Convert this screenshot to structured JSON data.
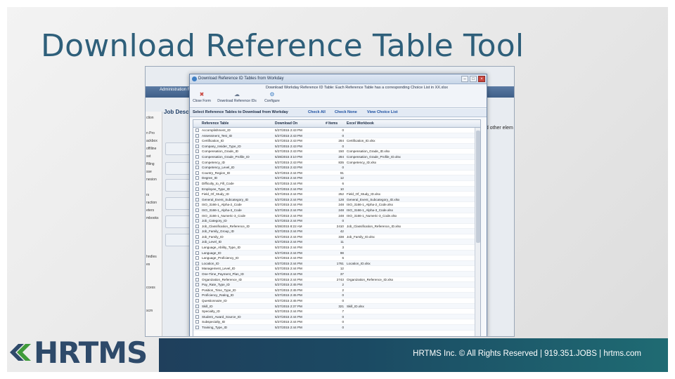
{
  "slide": {
    "title": "Download Reference Table Tool",
    "footer": "HRTMS Inc. © All Rights Reserved | 919.351.JOBS | hrtms.com",
    "logo_text": "HRTMS"
  },
  "background_app": {
    "topbar_label": "Administration Ref",
    "page_header": "Job Descr",
    "right_text": "nd other elem",
    "left_items": [
      "ction",
      "",
      "n Pro",
      "ackbox",
      "offiline",
      "sst",
      "ffiling",
      "sse",
      "nesion",
      "",
      "rs",
      "raction",
      "eters",
      "mbooks",
      "",
      "",
      "",
      "",
      "hndles",
      "es",
      "",
      "",
      "ccess",
      "",
      "",
      "scm"
    ]
  },
  "dialog": {
    "title": "Download Reference ID Tables from Workday",
    "status": "Download Workday Reference ID Table: Each Reference Table has a corresponding Choice List in XX.xlsx",
    "ribbon": [
      {
        "label": "Close Form",
        "icon": "close-form-icon"
      },
      {
        "label": "Download Reference IDs",
        "icon": "download-icon"
      },
      {
        "label": "Configure",
        "icon": "gear-icon"
      }
    ],
    "select_label": "Select Reference Tables to Download from Workday",
    "links": [
      "Check All",
      "Check None",
      "View Choice List"
    ],
    "columns": [
      "Reference Table",
      "Download On",
      "# Items",
      "Excel Workbook"
    ]
  },
  "rows": [
    {
      "name": "Accomplishment_ID",
      "date": "5/27/2015 2:43 PM",
      "items": "0",
      "wb": ""
    },
    {
      "name": "Assessment_Test_ID",
      "date": "5/27/2015 2:43 PM",
      "items": "0",
      "wb": ""
    },
    {
      "name": "Certification_ID",
      "date": "5/27/2015 2:43 PM",
      "items": "284",
      "wb": "Certification_ID.xlsx"
    },
    {
      "name": "Company_Insider_Type_ID",
      "date": "5/27/2015 2:43 PM",
      "items": "0",
      "wb": ""
    },
    {
      "name": "Compensation_Grade_ID",
      "date": "5/27/2015 2:43 PM",
      "items": "150",
      "wb": "Compensation_Grade_ID.xlsx"
    },
    {
      "name": "Compensation_Grade_Profile_ID",
      "date": "5/28/2015 3:10 PM",
      "items": "284",
      "wb": "Compensation_Grade_Profile_ID.xlsx"
    },
    {
      "name": "Competency_ID",
      "date": "5/27/2015 2:43 PM",
      "items": "835",
      "wb": "Competency_ID.xlsx"
    },
    {
      "name": "Competency_Level_ID",
      "date": "5/27/2015 2:43 PM",
      "items": "0",
      "wb": ""
    },
    {
      "name": "Country_Region_ID",
      "date": "5/27/2015 2:44 PM",
      "items": "91",
      "wb": ""
    },
    {
      "name": "Degree_ID",
      "date": "5/27/2015 2:44 PM",
      "items": "12",
      "wb": ""
    },
    {
      "name": "Difficulty_to_Fill_Code",
      "date": "5/27/2015 2:44 PM",
      "items": "6",
      "wb": ""
    },
    {
      "name": "Employee_Type_ID",
      "date": "5/27/2015 2:44 PM",
      "items": "10",
      "wb": ""
    },
    {
      "name": "Field_Of_Study_ID",
      "date": "5/27/2015 2:44 PM",
      "items": "252",
      "wb": "Field_Of_Study_ID.xlsx"
    },
    {
      "name": "General_Event_Subcategory_ID",
      "date": "5/27/2015 2:44 PM",
      "items": "128",
      "wb": "General_Event_Subcategory_ID.xlsx"
    },
    {
      "name": "ISO_3166-1_Alpha-2_Code",
      "date": "5/27/2015 2:44 PM",
      "items": "248",
      "wb": "ISO_3166-1_Alpha-2_Code.xlsx"
    },
    {
      "name": "ISO_3166-1_Alpha-3_Code",
      "date": "5/27/2015 2:44 PM",
      "items": "248",
      "wb": "ISO_3166-1_Alpha-3_Code.xlsx"
    },
    {
      "name": "ISO_3166-1_Numeric-3_Code",
      "date": "5/27/2015 2:44 PM",
      "items": "248",
      "wb": "ISO_3166-1_Numeric-3_Code.xlsx"
    },
    {
      "name": "Job_Category_ID",
      "date": "5/27/2015 2:44 PM",
      "items": "0",
      "wb": ""
    },
    {
      "name": "Job_Classification_Reference_ID",
      "date": "5/28/2015 8:22 AM",
      "items": "2410",
      "wb": "Job_Classification_Reference_ID.xlsx"
    },
    {
      "name": "Job_Family_Group_ID",
      "date": "5/27/2015 2:44 PM",
      "items": "42",
      "wb": ""
    },
    {
      "name": "Job_Family_ID",
      "date": "5/27/2015 2:44 PM",
      "items": "338",
      "wb": "Job_Family_ID.xlsx"
    },
    {
      "name": "Job_Level_ID",
      "date": "5/27/2015 2:44 PM",
      "items": "11",
      "wb": ""
    },
    {
      "name": "Language_Ability_Type_ID",
      "date": "5/27/2015 2:44 PM",
      "items": "3",
      "wb": ""
    },
    {
      "name": "Language_ID",
      "date": "5/27/2015 2:44 PM",
      "items": "98",
      "wb": ""
    },
    {
      "name": "Language_Proficiency_ID",
      "date": "5/27/2015 2:44 PM",
      "items": "6",
      "wb": ""
    },
    {
      "name": "Location_ID",
      "date": "5/27/2015 2:44 PM",
      "items": "1761",
      "wb": "Location_ID.xlsx"
    },
    {
      "name": "Management_Level_ID",
      "date": "5/27/2015 2:44 PM",
      "items": "12",
      "wb": ""
    },
    {
      "name": "One-Time_Payment_Plan_ID",
      "date": "5/27/2015 2:44 PM",
      "items": "37",
      "wb": ""
    },
    {
      "name": "Organization_Reference_ID",
      "date": "5/27/2015 2:44 PM",
      "items": "2743",
      "wb": "Organization_Reference_ID.xlsx"
    },
    {
      "name": "Pay_Rate_Type_ID",
      "date": "5/27/2015 2:45 PM",
      "items": "2",
      "wb": ""
    },
    {
      "name": "Position_Time_Type_ID",
      "date": "5/27/2015 2:45 PM",
      "items": "2",
      "wb": ""
    },
    {
      "name": "Proficiency_Rating_ID",
      "date": "5/27/2015 2:45 PM",
      "items": "0",
      "wb": ""
    },
    {
      "name": "Questionnaire_ID",
      "date": "5/27/2015 2:45 PM",
      "items": "0",
      "wb": ""
    },
    {
      "name": "Skill_ID",
      "date": "5/27/2015 2:37 PM",
      "items": "321",
      "wb": "Skill_ID.xlsx"
    },
    {
      "name": "Specialty_ID",
      "date": "5/27/2015 2:44 PM",
      "items": "7",
      "wb": ""
    },
    {
      "name": "Student_Award_Source_ID",
      "date": "5/27/2015 2:44 PM",
      "items": "0",
      "wb": ""
    },
    {
      "name": "Subspecialty_ID",
      "date": "5/27/2015 2:44 PM",
      "items": "0",
      "wb": ""
    },
    {
      "name": "Training_Type_ID",
      "date": "5/27/2015 2:44 PM",
      "items": "0",
      "wb": ""
    }
  ]
}
